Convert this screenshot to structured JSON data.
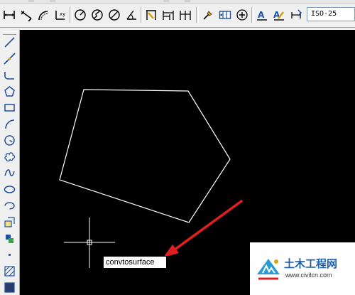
{
  "toolbar": {
    "buttons": [
      "linear-dimension-icon",
      "aligned-dimension-icon",
      "arc-length-icon",
      "ordinate-icon",
      "radius-icon",
      "jogged-icon",
      "diameter-icon",
      "angular-icon",
      "quick-dimension-icon",
      "baseline-icon",
      "continue-icon",
      "tolerance-icon",
      "center-mark-icon",
      "quick-leader-icon",
      "dimension-edit-icon",
      "dimension-text-edit-icon",
      "dimension-update-icon"
    ],
    "dimension_style": "ISO-25"
  },
  "left_toolbar": {
    "tools": [
      "line-icon",
      "construction-line-icon",
      "polyline-icon",
      "polygon-icon",
      "rectangle-icon",
      "arc-icon",
      "circle-icon",
      "revision-cloud-icon",
      "spline-icon",
      "ellipse-icon",
      "ellipse-arc-icon",
      "insert-block-icon",
      "make-block-icon",
      "point-icon",
      "hatch-icon",
      "gradient-icon",
      "region-icon"
    ]
  },
  "canvas": {
    "background": "#000000",
    "stroke": "#ffffff",
    "arrow_color": "#e02020"
  },
  "command_tooltip": "convtosurface",
  "watermark": {
    "title": "土木工程网",
    "url": "www.civilcn.com",
    "color": "#1f5fa8"
  }
}
